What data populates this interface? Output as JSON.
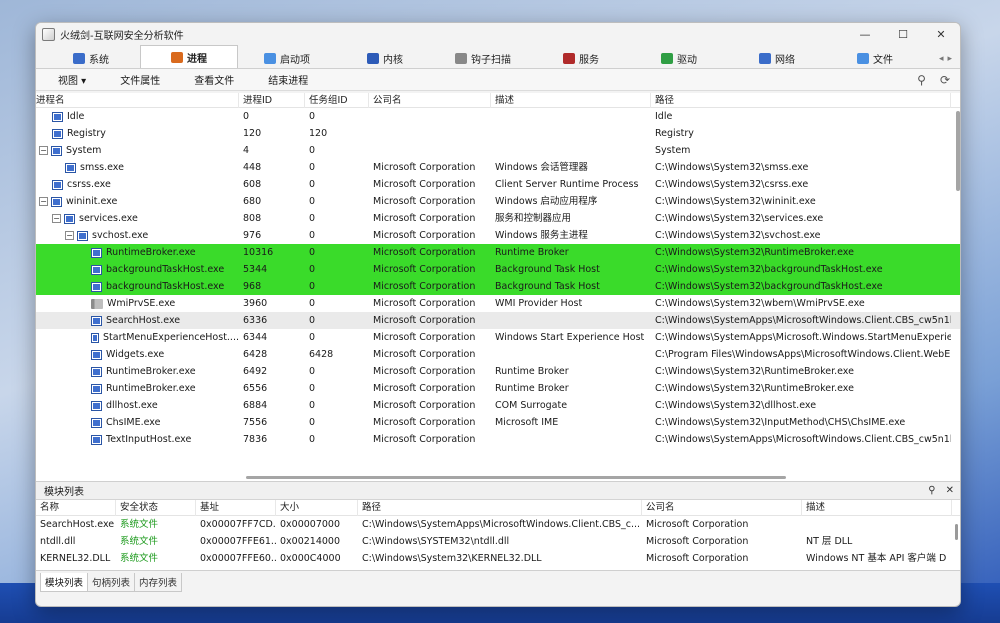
{
  "window": {
    "title": "火绒剑-互联网安全分析软件"
  },
  "tabs": [
    {
      "label": "系统",
      "icon": "monitor-icon",
      "color": "#3a6cc9"
    },
    {
      "label": "进程",
      "icon": "process-icon",
      "color": "#d96a1e",
      "active": true
    },
    {
      "label": "启动项",
      "icon": "startup-icon",
      "color": "#4a90e2"
    },
    {
      "label": "内核",
      "icon": "kernel-icon",
      "color": "#2d5bb8"
    },
    {
      "label": "钩子扫描",
      "icon": "hook-icon",
      "color": "#888888"
    },
    {
      "label": "服务",
      "icon": "service-icon",
      "color": "#b02a2a"
    },
    {
      "label": "驱动",
      "icon": "driver-icon",
      "color": "#2f9e44"
    },
    {
      "label": "网络",
      "icon": "network-icon",
      "color": "#3a6cc9"
    },
    {
      "label": "文件",
      "icon": "file-icon",
      "color": "#4a90e2"
    }
  ],
  "menu": [
    "视图 ▾",
    "文件属性",
    "查看文件",
    "结束进程"
  ],
  "proc_columns": [
    "进程名",
    "进程ID",
    "任务组ID",
    "公司名",
    "描述",
    "路径"
  ],
  "processes": [
    {
      "indent": 1,
      "exp": "",
      "icon": "p",
      "name": "Idle",
      "pid": "0",
      "tgid": "0",
      "company": "",
      "desc": "",
      "path": "Idle"
    },
    {
      "indent": 1,
      "exp": "",
      "icon": "p",
      "name": "Registry",
      "pid": "120",
      "tgid": "120",
      "company": "",
      "desc": "",
      "path": "Registry"
    },
    {
      "indent": 0,
      "exp": "-",
      "icon": "p",
      "name": "System",
      "pid": "4",
      "tgid": "0",
      "company": "",
      "desc": "",
      "path": "System"
    },
    {
      "indent": 2,
      "exp": "",
      "icon": "p",
      "name": "smss.exe",
      "pid": "448",
      "tgid": "0",
      "company": "Microsoft Corporation",
      "desc": "Windows 会话管理器",
      "path": "C:\\Windows\\System32\\smss.exe"
    },
    {
      "indent": 1,
      "exp": "",
      "icon": "p",
      "name": "csrss.exe",
      "pid": "608",
      "tgid": "0",
      "company": "Microsoft Corporation",
      "desc": "Client Server Runtime Process",
      "path": "C:\\Windows\\System32\\csrss.exe"
    },
    {
      "indent": 0,
      "exp": "-",
      "icon": "p",
      "name": "wininit.exe",
      "pid": "680",
      "tgid": "0",
      "company": "Microsoft Corporation",
      "desc": "Windows 启动应用程序",
      "path": "C:\\Windows\\System32\\wininit.exe"
    },
    {
      "indent": 1,
      "exp": "-",
      "icon": "p",
      "name": "services.exe",
      "pid": "808",
      "tgid": "0",
      "company": "Microsoft Corporation",
      "desc": "服务和控制器应用",
      "path": "C:\\Windows\\System32\\services.exe"
    },
    {
      "indent": 2,
      "exp": "-",
      "icon": "p",
      "name": "svchost.exe",
      "pid": "976",
      "tgid": "0",
      "company": "Microsoft Corporation",
      "desc": "Windows 服务主进程",
      "path": "C:\\Windows\\System32\\svchost.exe"
    },
    {
      "indent": 4,
      "exp": "",
      "icon": "p",
      "name": "RuntimeBroker.exe",
      "pid": "10316",
      "tgid": "0",
      "company": "Microsoft Corporation",
      "desc": "Runtime Broker",
      "path": "C:\\Windows\\System32\\RuntimeBroker.exe",
      "sel": true
    },
    {
      "indent": 4,
      "exp": "",
      "icon": "p",
      "name": "backgroundTaskHost.exe",
      "pid": "5344",
      "tgid": "0",
      "company": "Microsoft Corporation",
      "desc": "Background Task Host",
      "path": "C:\\Windows\\System32\\backgroundTaskHost.exe",
      "sel": true
    },
    {
      "indent": 4,
      "exp": "",
      "icon": "p",
      "name": "backgroundTaskHost.exe",
      "pid": "968",
      "tgid": "0",
      "company": "Microsoft Corporation",
      "desc": "Background Task Host",
      "path": "C:\\Windows\\System32\\backgroundTaskHost.exe",
      "sel": true
    },
    {
      "indent": 4,
      "exp": "",
      "icon": "w",
      "name": "WmiPrvSE.exe",
      "pid": "3960",
      "tgid": "0",
      "company": "Microsoft Corporation",
      "desc": "WMI Provider Host",
      "path": "C:\\Windows\\System32\\wbem\\WmiPrvSE.exe"
    },
    {
      "indent": 4,
      "exp": "",
      "icon": "p",
      "name": "SearchHost.exe",
      "pid": "6336",
      "tgid": "0",
      "company": "Microsoft Corporation",
      "desc": "",
      "path": "C:\\Windows\\SystemApps\\MicrosoftWindows.Client.CBS_cw5n1h",
      "hover": true
    },
    {
      "indent": 4,
      "exp": "",
      "icon": "p",
      "name": "StartMenuExperienceHost....",
      "pid": "6344",
      "tgid": "0",
      "company": "Microsoft Corporation",
      "desc": "Windows Start Experience Host",
      "path": "C:\\Windows\\SystemApps\\Microsoft.Windows.StartMenuExperie"
    },
    {
      "indent": 4,
      "exp": "",
      "icon": "p",
      "name": "Widgets.exe",
      "pid": "6428",
      "tgid": "6428",
      "company": "Microsoft Corporation",
      "desc": "",
      "path": "C:\\Program Files\\WindowsApps\\MicrosoftWindows.Client.WebE"
    },
    {
      "indent": 4,
      "exp": "",
      "icon": "p",
      "name": "RuntimeBroker.exe",
      "pid": "6492",
      "tgid": "0",
      "company": "Microsoft Corporation",
      "desc": "Runtime Broker",
      "path": "C:\\Windows\\System32\\RuntimeBroker.exe"
    },
    {
      "indent": 4,
      "exp": "",
      "icon": "p",
      "name": "RuntimeBroker.exe",
      "pid": "6556",
      "tgid": "0",
      "company": "Microsoft Corporation",
      "desc": "Runtime Broker",
      "path": "C:\\Windows\\System32\\RuntimeBroker.exe"
    },
    {
      "indent": 4,
      "exp": "",
      "icon": "p",
      "name": "dllhost.exe",
      "pid": "6884",
      "tgid": "0",
      "company": "Microsoft Corporation",
      "desc": "COM Surrogate",
      "path": "C:\\Windows\\System32\\dllhost.exe"
    },
    {
      "indent": 4,
      "exp": "",
      "icon": "p",
      "name": "ChsIME.exe",
      "pid": "7556",
      "tgid": "0",
      "company": "Microsoft Corporation",
      "desc": "Microsoft IME",
      "path": "C:\\Windows\\System32\\InputMethod\\CHS\\ChsIME.exe"
    },
    {
      "indent": 4,
      "exp": "",
      "icon": "p",
      "name": "TextInputHost.exe",
      "pid": "7836",
      "tgid": "0",
      "company": "Microsoft Corporation",
      "desc": "",
      "path": "C:\\Windows\\SystemApps\\MicrosoftWindows.Client.CBS_cw5n1h"
    }
  ],
  "module_panel": {
    "title": "模块列表"
  },
  "mod_columns": [
    "名称",
    "安全状态",
    "基址",
    "大小",
    "路径",
    "公司名",
    "描述"
  ],
  "modules": [
    {
      "name": "SearchHost.exe",
      "sec": "系统文件",
      "base": "0x00007FF7CD...",
      "size": "0x00007000",
      "path": "C:\\Windows\\SystemApps\\MicrosoftWindows.Client.CBS_c...",
      "company": "Microsoft Corporation",
      "desc": ""
    },
    {
      "name": "ntdll.dll",
      "sec": "系统文件",
      "base": "0x00007FFE61...",
      "size": "0x00214000",
      "path": "C:\\Windows\\SYSTEM32\\ntdll.dll",
      "company": "Microsoft Corporation",
      "desc": "NT 层 DLL"
    },
    {
      "name": "KERNEL32.DLL",
      "sec": "系统文件",
      "base": "0x00007FFE60...",
      "size": "0x000C4000",
      "path": "C:\\Windows\\System32\\KERNEL32.DLL",
      "company": "Microsoft Corporation",
      "desc": "Windows NT 基本 API 客户端 D"
    }
  ],
  "bottom_tabs": [
    "模块列表",
    "句柄列表",
    "内存列表"
  ],
  "colors": {
    "selected_row": "#3adb2a",
    "safe_text": "#1c9a1c"
  }
}
